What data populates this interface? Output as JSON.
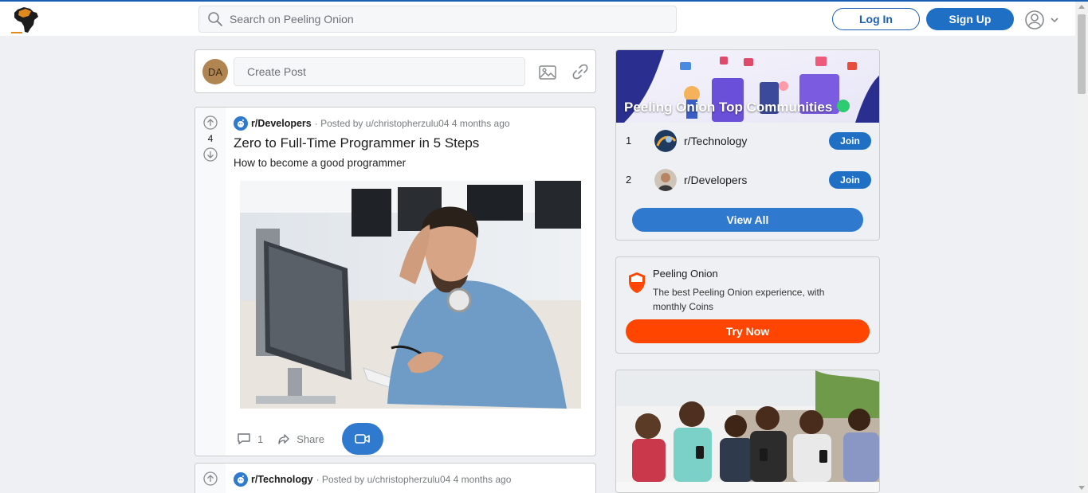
{
  "app": {
    "brand": "Peeling Onion",
    "logo_icon": "africa-map-logo"
  },
  "header": {
    "search_placeholder": "Search on Peeling Onion",
    "login_label": "Log In",
    "signup_label": "Sign Up"
  },
  "create_post": {
    "avatar_initials": "DA",
    "placeholder": "Create Post"
  },
  "posts": [
    {
      "subreddit": "r/Developers",
      "meta": "· Posted by u/christopherzulu04 4 months ago",
      "votes": "4",
      "title": "Zero to Full-Time Programmer in 5 Steps",
      "description": "How to become a good programmer",
      "comments": "1",
      "share_label": "Share"
    },
    {
      "subreddit": "r/Technology",
      "meta": "· Posted by u/christopherzulu04 4 months ago"
    }
  ],
  "sidebar": {
    "communities": {
      "title": "Peeling Onion Top Communities",
      "items": [
        {
          "rank": "1",
          "name": "r/Technology",
          "join_label": "Join"
        },
        {
          "rank": "2",
          "name": "r/Developers",
          "join_label": "Join"
        }
      ],
      "view_all_label": "View All"
    },
    "premium": {
      "title": "Peeling Onion",
      "description": "The best Peeling Onion experience, with monthly Coins",
      "button_label": "Try Now"
    }
  },
  "colors": {
    "accent": "#1f6fc5",
    "cta": "#ff4500",
    "background": "#eef0f3"
  }
}
